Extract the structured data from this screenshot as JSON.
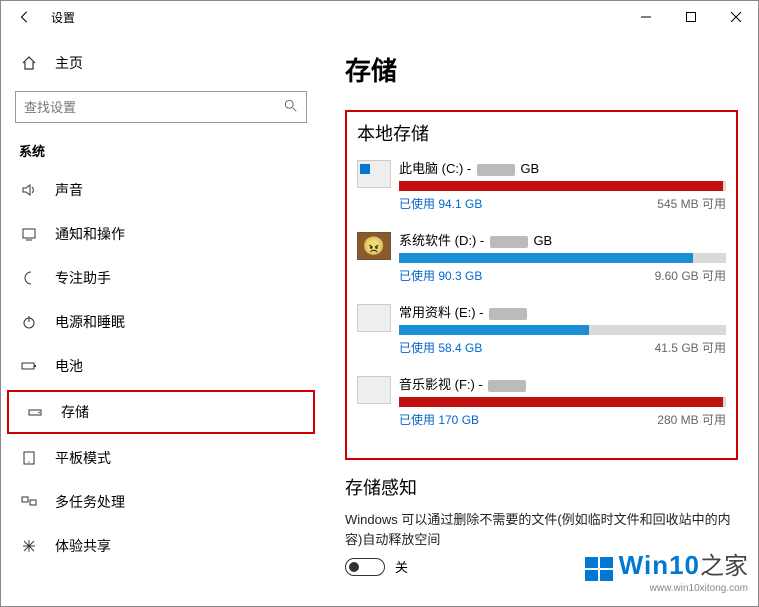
{
  "window": {
    "title": "设置"
  },
  "sidebar": {
    "home_label": "主页",
    "search_placeholder": "查找设置",
    "section_label": "系统",
    "items": [
      {
        "icon": "sound",
        "label": "声音"
      },
      {
        "icon": "notify",
        "label": "通知和操作"
      },
      {
        "icon": "moon",
        "label": "专注助手"
      },
      {
        "icon": "power",
        "label": "电源和睡眠"
      },
      {
        "icon": "battery",
        "label": "电池"
      },
      {
        "icon": "storage",
        "label": "存储",
        "active": true
      },
      {
        "icon": "tablet",
        "label": "平板模式"
      },
      {
        "icon": "multitask",
        "label": "多任务处理"
      },
      {
        "icon": "share",
        "label": "体验共享"
      }
    ]
  },
  "main": {
    "page_title": "存储",
    "local_storage_title": "本地存储",
    "drives": [
      {
        "name": "此电脑 (C:) - ",
        "total_obscured": true,
        "total_suffix": " GB",
        "fill_pct": 99,
        "fill_color": "red",
        "used": "已使用 94.1 GB",
        "free": "545 MB 可用",
        "icon": "win"
      },
      {
        "name": "系统软件 (D:) - ",
        "total_obscured": true,
        "total_suffix": " GB",
        "fill_pct": 90,
        "fill_color": "blue",
        "used": "已使用 90.3 GB",
        "free": "9.60 GB 可用",
        "icon": "face"
      },
      {
        "name": "常用资料 (E:) - ",
        "total_obscured": true,
        "total_suffix": "",
        "fill_pct": 58,
        "fill_color": "blue",
        "used": "已使用 58.4 GB",
        "free": "41.5 GB 可用",
        "icon": "plain"
      },
      {
        "name": "音乐影视 (F:) - ",
        "total_obscured": true,
        "total_suffix": "",
        "fill_pct": 99,
        "fill_color": "red",
        "used": "已使用 170 GB",
        "free": "280 MB 可用",
        "icon": "plain"
      }
    ],
    "sense_title": "存储感知",
    "sense_desc": "Windows 可以通过删除不需要的文件(例如临时文件和回收站中的内容)自动释放空间",
    "toggle_label": "关"
  },
  "watermark": {
    "brand": "Win10",
    "small": "之家",
    "url": "www.win10xitong.com"
  }
}
